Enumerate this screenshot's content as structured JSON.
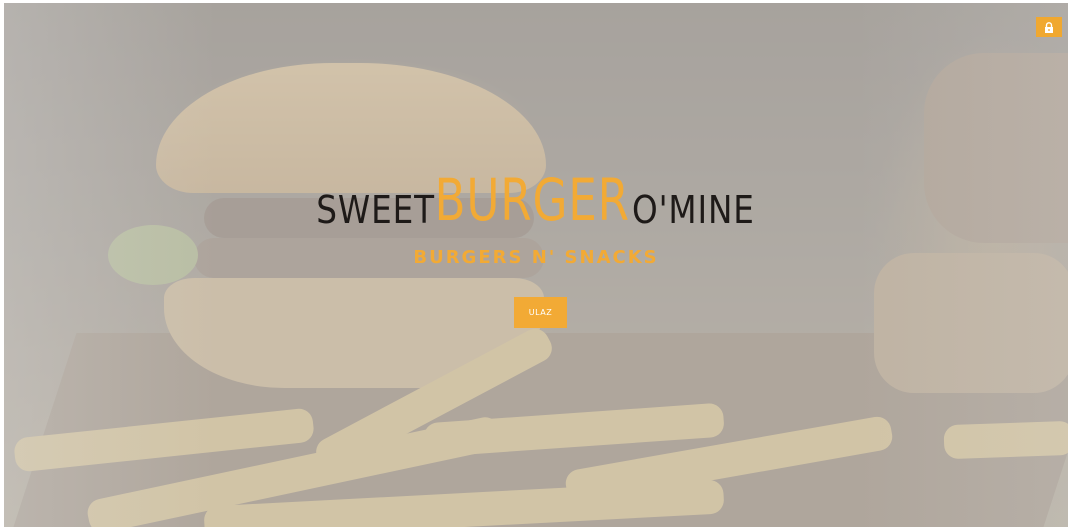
{
  "brand": {
    "part1": "SWEET",
    "part2": "BURGER",
    "part3": "O'MINE"
  },
  "tagline": "BURGERS N' SNACKS",
  "enter_button": "ULAZ",
  "icons": {
    "lock": "lock-icon"
  },
  "colors": {
    "accent": "#f2aa35",
    "brand_dark": "#1e1a18"
  }
}
